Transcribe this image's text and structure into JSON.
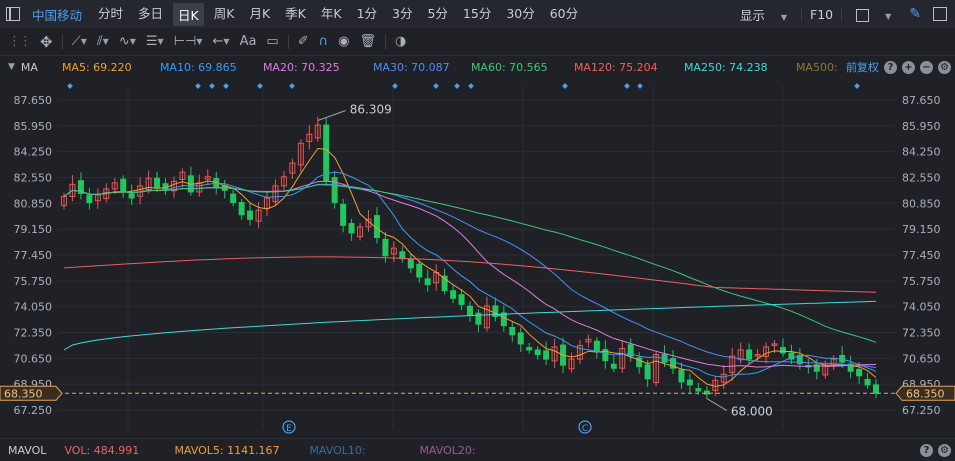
{
  "toolbar": {
    "stock_name": "中国移动",
    "timeframes": [
      "分时",
      "多日",
      "日K",
      "周K",
      "月K",
      "季K",
      "年K",
      "1分",
      "3分",
      "5分",
      "15分",
      "30分",
      "60分"
    ],
    "active_timeframe": "日K",
    "display_label": "显示",
    "f10_label": "F10"
  },
  "drawing_tools": {
    "text_tool_label": "Aa"
  },
  "indicators": {
    "main_label": "MA",
    "items": [
      {
        "label": "MA5: 69.220",
        "color": "#f0a030"
      },
      {
        "label": "MA10: 69.865",
        "color": "#3d9bf0"
      },
      {
        "label": "MA20: 70.325",
        "color": "#e07ce0"
      },
      {
        "label": "MA30: 70.087",
        "color": "#4d8df5"
      },
      {
        "label": "MA60: 70.565",
        "color": "#3dc77a"
      },
      {
        "label": "MA120: 75.204",
        "color": "#f06060"
      },
      {
        "label": "MA250: 74.238",
        "color": "#40d8d8"
      },
      {
        "label": "MA500:",
        "color": "#8a7a3a"
      }
    ],
    "adjust_label": "前复权"
  },
  "volume": {
    "label": "MAVOL",
    "items": [
      {
        "label": "VOL: 484.991",
        "color": "#f06060"
      },
      {
        "label": "MAVOL5: 1141.167",
        "color": "#f0a030"
      },
      {
        "label": "MAVOL10:",
        "color": "#2f6f9a"
      },
      {
        "label": "MAVOL20:",
        "color": "#9a5a9a"
      }
    ]
  },
  "chart_data": {
    "type": "candlestick",
    "y_ticks": [
      87.65,
      85.95,
      84.25,
      82.55,
      80.85,
      79.15,
      77.45,
      75.75,
      74.05,
      72.35,
      70.65,
      68.95,
      67.25
    ],
    "y_tick_labels": [
      "87.650",
      "85.950",
      "84.250",
      "82.550",
      "80.850",
      "79.150",
      "77.450",
      "75.750",
      "74.050",
      "72.350",
      "70.650",
      "68.950",
      "67.250"
    ],
    "current_price": 68.35,
    "current_price_label": "68.350",
    "high_label": "86.309",
    "low_label": "68.000",
    "marker_e": "E",
    "marker_c": "C",
    "colors": {
      "up": "#f0524f",
      "down": "#22c55e",
      "ma5": "#f0a030",
      "ma10": "#3d9bf0",
      "ma20": "#e07ce0",
      "ma30": "#4d8df5",
      "ma60": "#3dc77a",
      "ma120": "#f06060",
      "ma250": "#40d8d8",
      "price_line": "#e8a45c"
    },
    "closes": [
      81.3,
      82.1,
      81.5,
      80.9,
      81.4,
      81.8,
      82.2,
      81.6,
      81.2,
      82.0,
      82.5,
      81.9,
      81.8,
      82.3,
      82.9,
      81.6,
      82.2,
      82.6,
      81.9,
      81.7,
      80.9,
      80.1,
      79.8,
      80.4,
      81.2,
      82.0,
      82.6,
      83.5,
      84.8,
      85.4,
      86.0,
      82.3,
      80.9,
      79.4,
      78.9,
      79.3,
      79.8,
      78.6,
      77.4,
      77.9,
      77.2,
      76.6,
      76.0,
      75.5,
      76.3,
      75.1,
      74.6,
      74.2,
      73.5,
      72.9,
      74.1,
      73.4,
      72.8,
      72.2,
      71.6,
      71.2,
      70.9,
      70.6,
      71.4,
      70.2,
      70.6,
      71.5,
      71.9,
      71.1,
      70.5,
      70.0,
      71.3,
      70.8,
      70.1,
      69.3,
      70.9,
      70.4,
      70.0,
      69.1,
      68.9,
      68.5,
      68.3,
      69.2,
      69.6,
      70.8,
      71.2,
      70.6,
      70.9,
      71.4,
      71.6,
      71.0,
      70.6,
      70.3,
      70.1,
      69.8,
      70.2,
      70.6,
      70.4,
      69.8,
      69.5,
      68.9,
      68.35
    ]
  }
}
